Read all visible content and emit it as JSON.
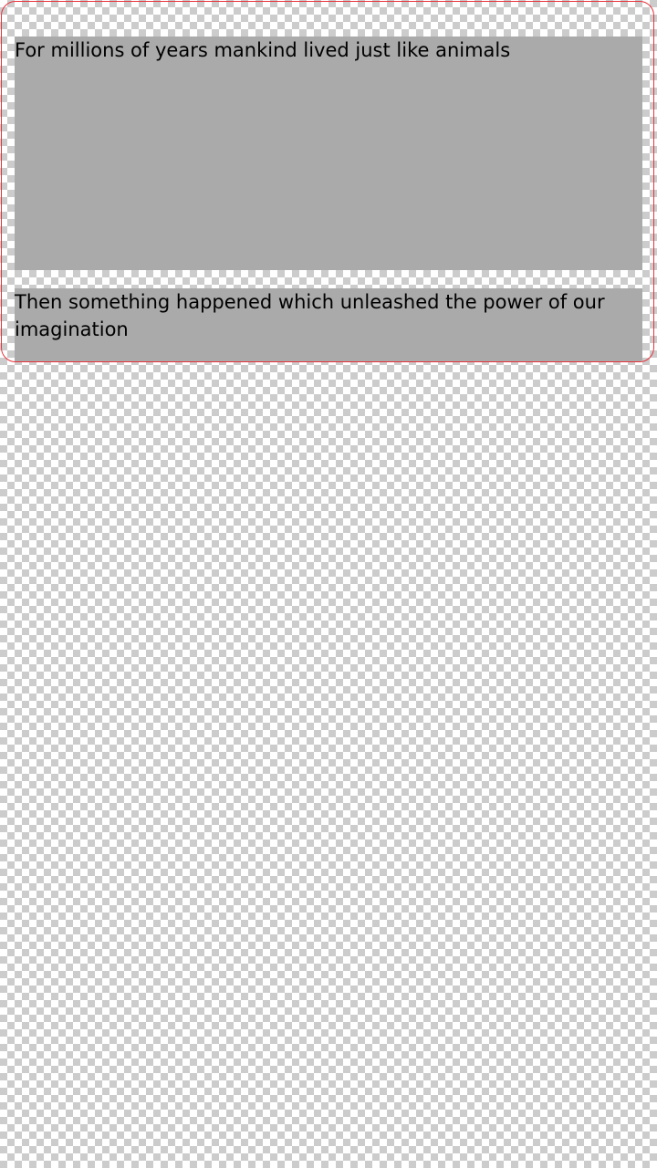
{
  "colors": {
    "frame_border": "#e8323c",
    "block_background": "#aaaaaa",
    "text": "#000000"
  },
  "panels": [
    {
      "text": "For millions of years mankind lived just like animals"
    },
    {
      "text": "Then something happened which unleashed the power of our imagination"
    }
  ]
}
